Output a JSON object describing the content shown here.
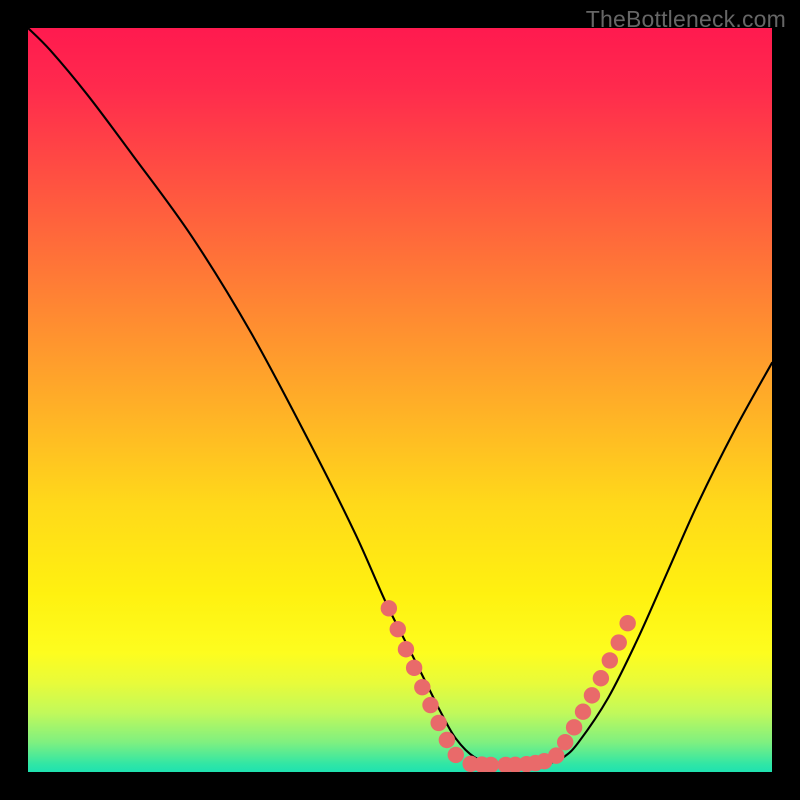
{
  "watermark": "TheBottleneck.com",
  "colors": {
    "dot": "#e96a6a",
    "line": "#000000",
    "frame": "#000000"
  },
  "chart_data": {
    "type": "line",
    "title": "",
    "xlabel": "",
    "ylabel": "",
    "xlim": [
      0,
      100
    ],
    "ylim": [
      0,
      100
    ],
    "series": [
      {
        "name": "curve",
        "x": [
          0,
          3,
          8,
          14,
          22,
          30,
          38,
          44,
          48,
          51,
          53.5,
          55.5,
          57.5,
          60,
          63,
          67,
          70,
          72,
          74,
          78,
          82,
          86,
          90,
          95,
          100
        ],
        "y": [
          100,
          97,
          91,
          83,
          72,
          59,
          44,
          32,
          23,
          17,
          12,
          8,
          4.5,
          2,
          1,
          1,
          1.2,
          2,
          4,
          10,
          18,
          27,
          36,
          46,
          55
        ]
      }
    ],
    "markers_left": [
      {
        "x": 48.5,
        "y": 22
      },
      {
        "x": 49.7,
        "y": 19.2
      },
      {
        "x": 50.8,
        "y": 16.5
      },
      {
        "x": 51.9,
        "y": 14
      },
      {
        "x": 53.0,
        "y": 11.4
      },
      {
        "x": 54.1,
        "y": 9
      },
      {
        "x": 55.2,
        "y": 6.6
      },
      {
        "x": 56.3,
        "y": 4.3
      },
      {
        "x": 57.5,
        "y": 2.3
      }
    ],
    "markers_bottom": [
      {
        "x": 59.5,
        "y": 1.1
      },
      {
        "x": 61,
        "y": 1.0
      },
      {
        "x": 62.2,
        "y": 0.95
      },
      {
        "x": 64.2,
        "y": 0.95
      },
      {
        "x": 65.5,
        "y": 0.97
      },
      {
        "x": 67,
        "y": 1.05
      },
      {
        "x": 68.2,
        "y": 1.2
      },
      {
        "x": 69.4,
        "y": 1.45
      }
    ],
    "markers_right": [
      {
        "x": 71,
        "y": 2.2
      },
      {
        "x": 72.2,
        "y": 4
      },
      {
        "x": 73.4,
        "y": 6
      },
      {
        "x": 74.6,
        "y": 8.1
      },
      {
        "x": 75.8,
        "y": 10.3
      },
      {
        "x": 77,
        "y": 12.6
      },
      {
        "x": 78.2,
        "y": 15
      },
      {
        "x": 79.4,
        "y": 17.4
      },
      {
        "x": 80.6,
        "y": 20
      }
    ]
  }
}
